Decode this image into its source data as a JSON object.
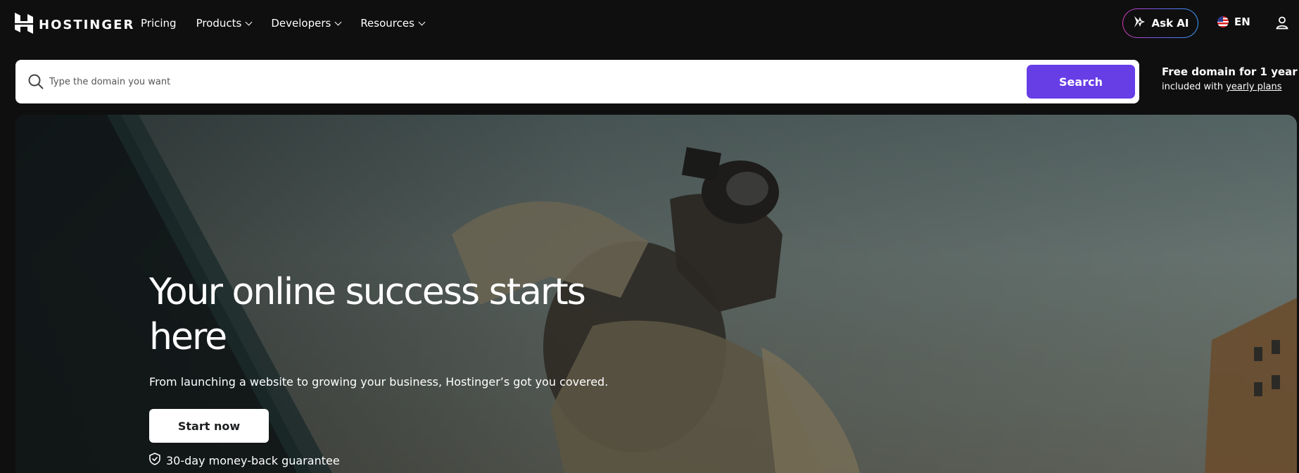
{
  "brand": {
    "name": "HOSTINGER"
  },
  "nav": {
    "items": [
      {
        "label": "Pricing",
        "has_dropdown": false
      },
      {
        "label": "Products",
        "has_dropdown": true
      },
      {
        "label": "Developers",
        "has_dropdown": true
      },
      {
        "label": "Resources",
        "has_dropdown": true
      }
    ],
    "ask_ai_label": "Ask AI",
    "language": "EN"
  },
  "search": {
    "placeholder": "Type the domain you want",
    "value": "",
    "button_label": "Search"
  },
  "promo": {
    "title": "Free domain for 1 year",
    "sub_prefix": "included with ",
    "sub_link": "yearly plans"
  },
  "hero": {
    "title": "Your online success starts here",
    "subtitle": "From launching a website to growing your business, Hostinger’s got you covered.",
    "cta_label": "Start now",
    "guarantee": "30-day money-back guarantee"
  },
  "colors": {
    "background": "#0f0f0f",
    "accent": "#673de6",
    "text": "#ffffff"
  },
  "icons": [
    "hostinger-logo-icon",
    "chevron-down-icon",
    "sparkle-icon",
    "us-flag-icon",
    "user-icon",
    "search-icon",
    "shield-check-icon"
  ]
}
